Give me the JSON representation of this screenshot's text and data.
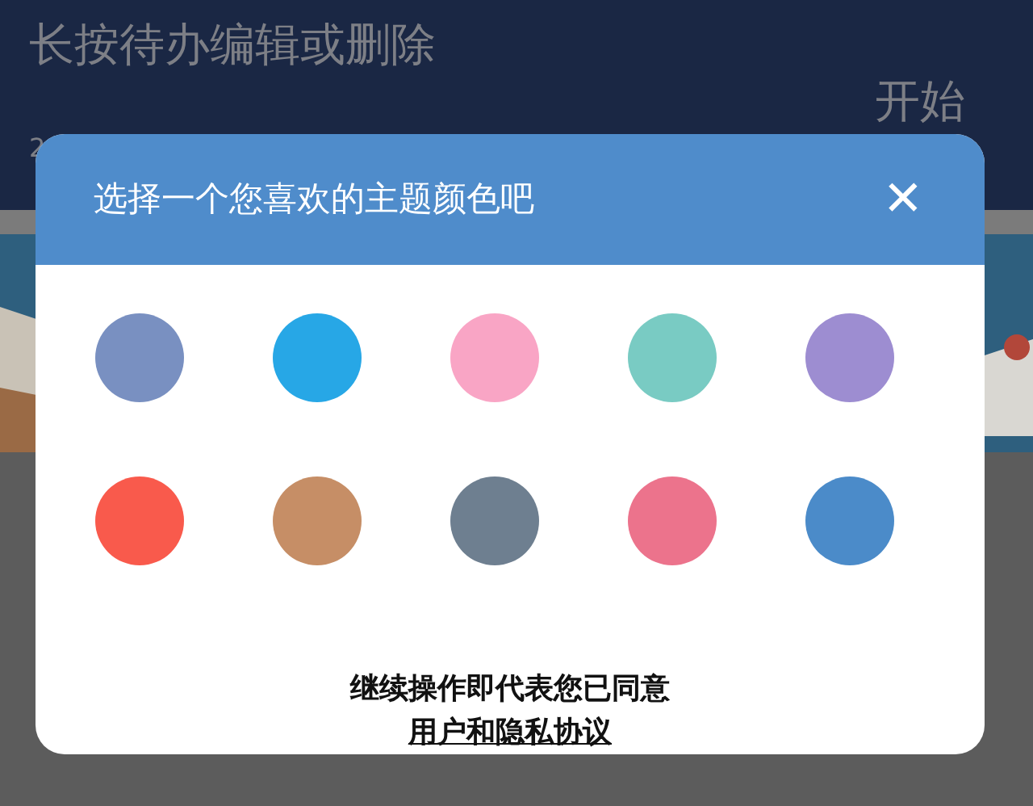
{
  "background": {
    "title": "长按待办编辑或删除",
    "start_label": "开始",
    "date_fragment": "2"
  },
  "dialog": {
    "title": "选择一个您喜欢的主题颜色吧",
    "close": "✕",
    "swatches": [
      {
        "color": "#7990c1"
      },
      {
        "color": "#27a7e6"
      },
      {
        "color": "#f9a5c5"
      },
      {
        "color": "#79cbc3"
      },
      {
        "color": "#9d8dd1"
      },
      {
        "color": "#f95a4c"
      },
      {
        "color": "#c68e66"
      },
      {
        "color": "#6e7f90"
      },
      {
        "color": "#ec738c"
      },
      {
        "color": "#4b8bc9"
      }
    ],
    "notice": "继续操作即代表您已同意",
    "link": "用户和隐私协议"
  }
}
